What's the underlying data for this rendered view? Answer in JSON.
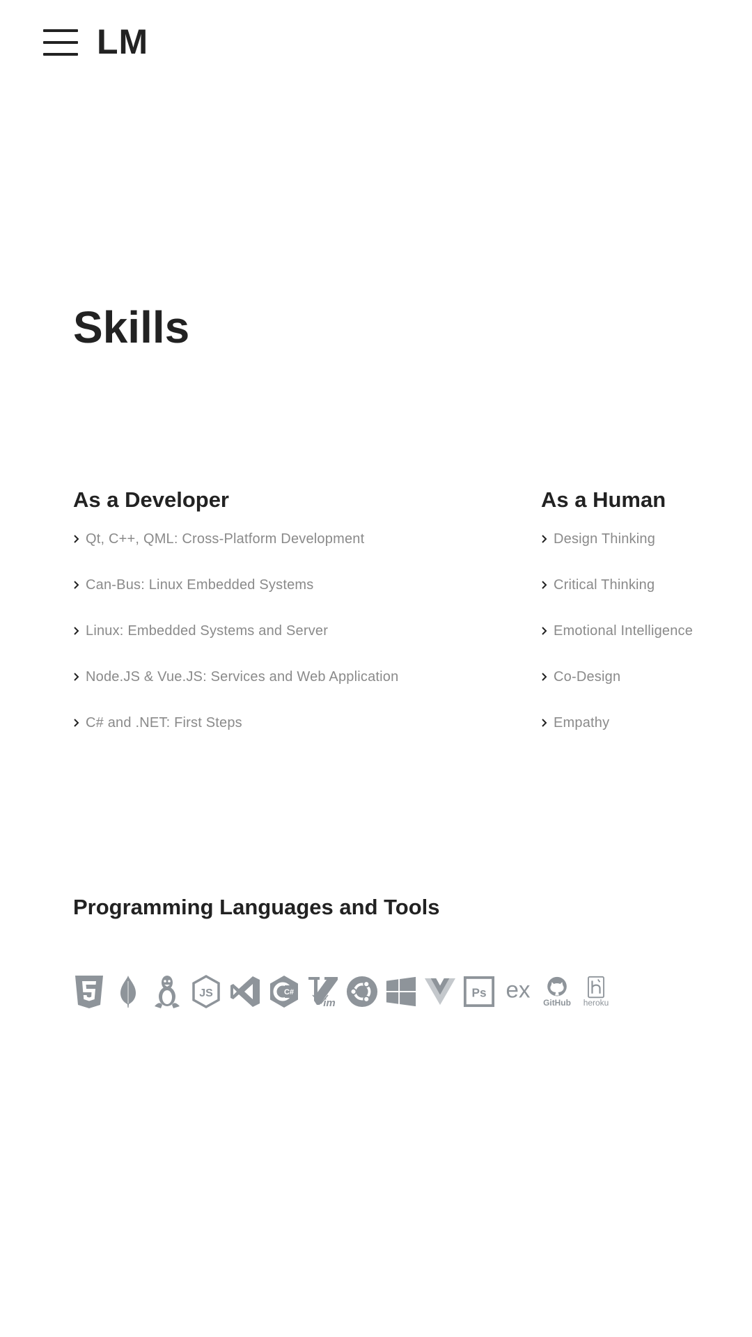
{
  "header": {
    "logo": "LM",
    "menu_icon": "hamburger-menu-icon"
  },
  "page": {
    "title": "Skills"
  },
  "developer": {
    "heading": "As a Developer",
    "items": [
      "Qt, C++, QML: Cross-Platform Development",
      "Can-Bus: Linux Embedded Systems",
      "Linux: Embedded Systems and Server",
      "Node.JS & Vue.JS: Services and Web Application",
      "C# and .NET: First Steps"
    ]
  },
  "human": {
    "heading": "As a Human",
    "items": [
      "Design Thinking",
      "Critical Thinking",
      "Emotional Intelligence",
      "Co-Design",
      "Empathy"
    ]
  },
  "tools": {
    "heading": "Programming Languages and Tools",
    "icon_color": "#8e949a",
    "icons": [
      "html5-icon",
      "mongodb-icon",
      "linux-icon",
      "nodejs-icon",
      "visual-studio-icon",
      "csharp-icon",
      "vim-icon",
      "ubuntu-icon",
      "windows-icon",
      "vuejs-icon",
      "photoshop-icon",
      "express-icon",
      "github-icon",
      "heroku-icon"
    ],
    "icon_labels": {
      "nodejs": "JS",
      "csharp": "C#",
      "vim": "im",
      "photoshop": "Ps",
      "express": "ex",
      "github": "GitHub",
      "heroku": "heroku"
    }
  }
}
